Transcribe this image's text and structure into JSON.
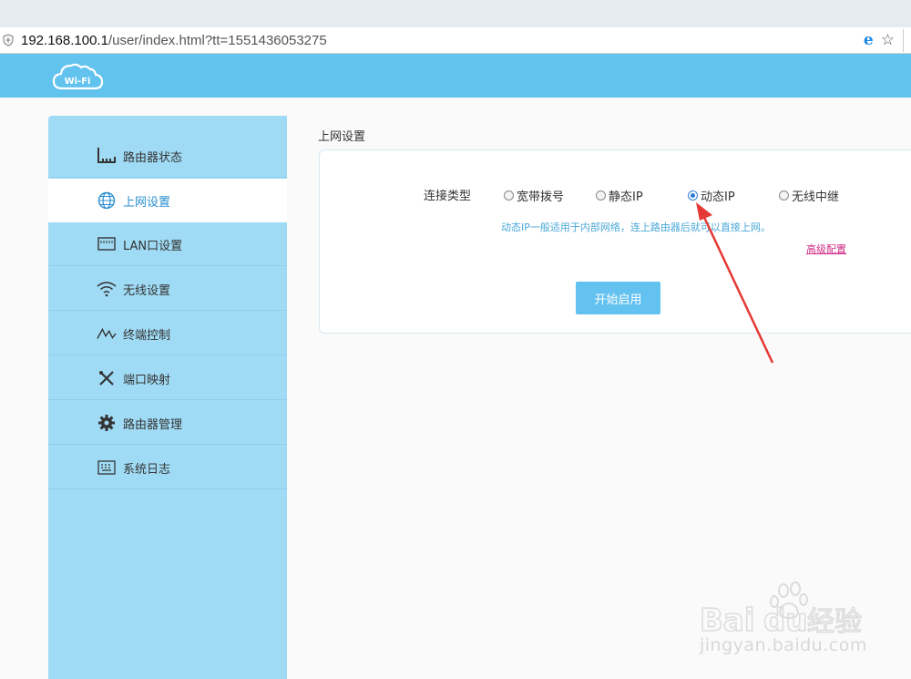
{
  "browser": {
    "url_host": "192.168.100.1",
    "url_path": "/user/index.html?tt=1551436053275",
    "icons": [
      "shield-icon",
      "ie-icon",
      "star-icon"
    ]
  },
  "header": {
    "logo_text": "Wi-Fi",
    "brand_color": "#62c3ef"
  },
  "sidebar": {
    "items": [
      {
        "label": "路由器状态",
        "icon": "router-status-icon"
      },
      {
        "label": "上网设置",
        "icon": "globe-icon",
        "active": true
      },
      {
        "label": "LAN口设置",
        "icon": "lan-port-icon"
      },
      {
        "label": "无线设置",
        "icon": "wifi-icon"
      },
      {
        "label": "终端控制",
        "icon": "terminal-chart-icon"
      },
      {
        "label": "端口映射",
        "icon": "tools-icon"
      },
      {
        "label": "路由器管理",
        "icon": "gear-icon"
      },
      {
        "label": "系统日志",
        "icon": "keyboard-icon"
      }
    ]
  },
  "main": {
    "title": "上网设置",
    "connection_label": "连接类型",
    "options": [
      {
        "label": "宽带拨号",
        "checked": false
      },
      {
        "label": "静态IP",
        "checked": false
      },
      {
        "label": "动态IP",
        "checked": true
      },
      {
        "label": "无线中继",
        "checked": false
      }
    ],
    "hint": "动态IP一般适用于内部网络，连上路由器后就可以直接上网。",
    "advanced_link": "高级配置",
    "start_button": "开始启用"
  },
  "watermark": {
    "logo": "Bai du 经验",
    "url": "jingyan.baidu.com"
  },
  "colors": {
    "sidebar_bg": "#a0dbf5",
    "active_text": "#2a8fd0",
    "hint_text": "#4aa8d8",
    "link_color": "#d12a84",
    "arrow_color": "#e53935"
  }
}
